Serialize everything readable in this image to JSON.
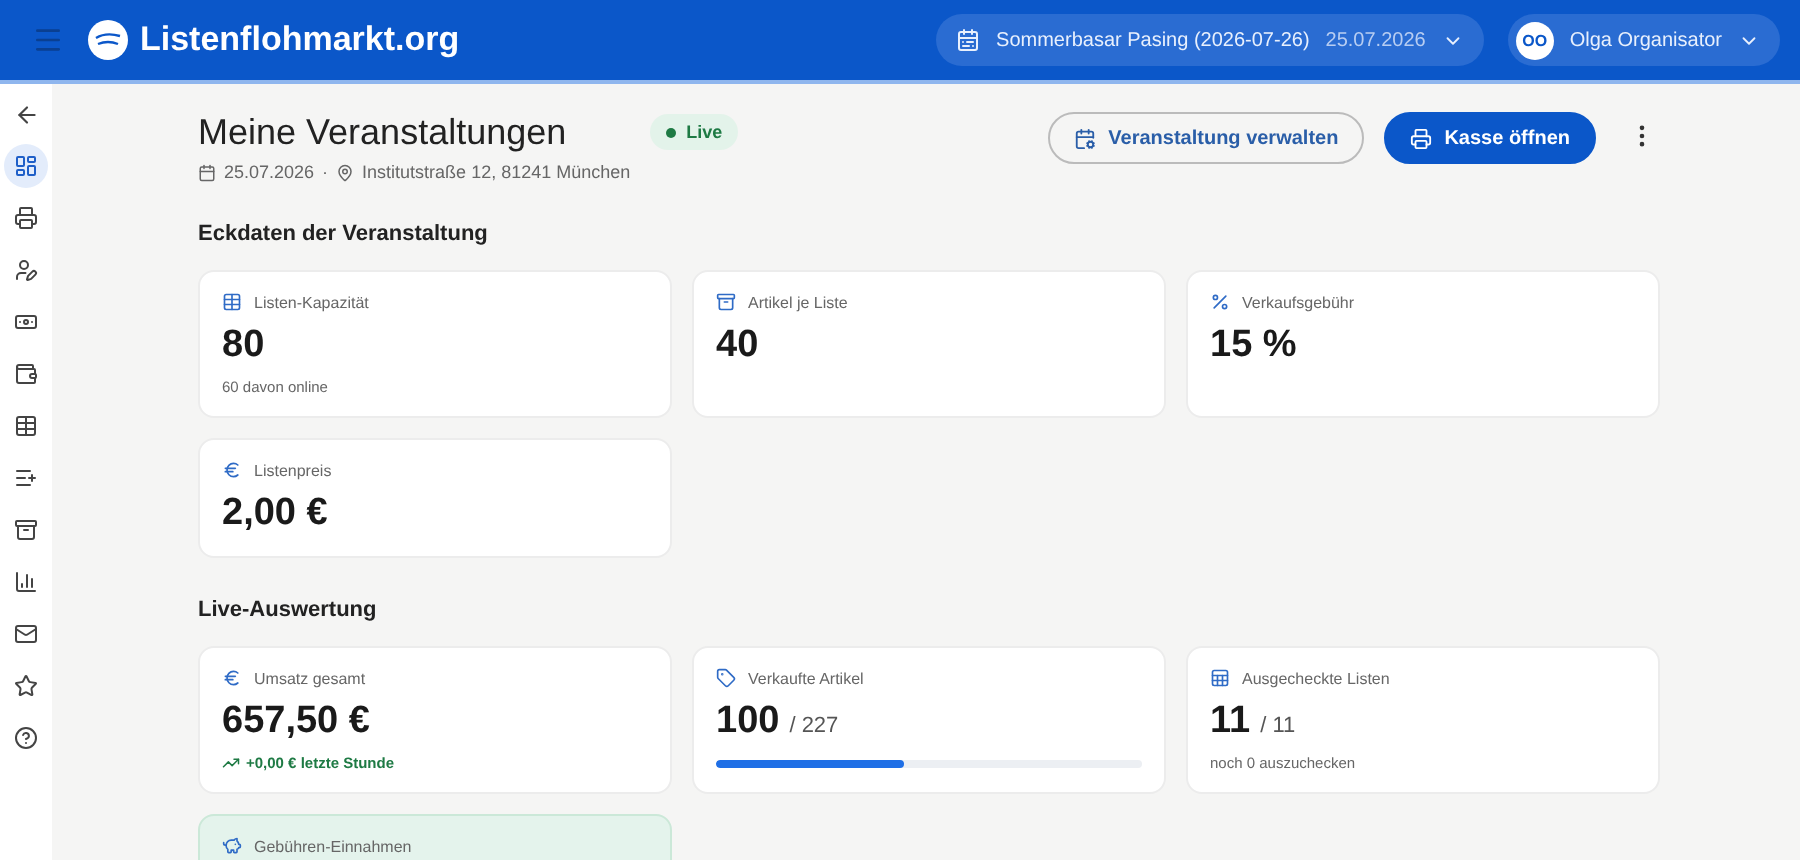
{
  "header": {
    "logo": "Listenflohmarkt.org",
    "event_selector": {
      "name": "Sommerbasar Pasing (2026-07-26)",
      "date": "25.07.2026"
    },
    "user": {
      "initials": "OO",
      "name": "Olga Organisator"
    }
  },
  "sidebar": {
    "items": [
      {
        "selected": true
      },
      {
        "selected": false
      },
      {
        "selected": false
      },
      {
        "selected": false
      },
      {
        "selected": false
      },
      {
        "selected": false
      },
      {
        "selected": false
      },
      {
        "selected": false
      },
      {
        "selected": false
      },
      {
        "selected": false
      },
      {
        "selected": false
      },
      {
        "selected": false
      }
    ]
  },
  "page": {
    "title": "Meine Veranstaltungen",
    "status": {
      "label": "Live",
      "kind": "live"
    },
    "date": "25.07.2026",
    "separator": "·",
    "address": "Institutstraße 12, 81241 München",
    "actions": [
      {
        "label": "Veranstaltung verwalten",
        "kind": "outline"
      },
      {
        "label": "Kasse öffnen",
        "kind": "primary"
      }
    ]
  },
  "sections": [
    {
      "title": "Eckdaten der Veranstaltung",
      "cards": [
        {
          "kind": "stat",
          "label": "Listen-Kapazität",
          "value": "80",
          "note": "60 davon online"
        },
        {
          "kind": "stat",
          "label": "Artikel je Liste",
          "value": "40"
        },
        {
          "kind": "stat",
          "label": "Verkaufsgebühr",
          "value": "15 %"
        },
        {
          "kind": "stat",
          "label": "Listenpreis",
          "value": "2,00 €"
        }
      ]
    },
    {
      "title": "Live-Auswertung",
      "cards": [
        {
          "kind": "trend",
          "label": "Umsatz gesamt",
          "value": "657,50 €",
          "trend": "+0,00 € letzte Stunde"
        },
        {
          "kind": "progress",
          "label": "Verkaufte Artikel",
          "value": "100",
          "total": "/ 227",
          "level": 0.44
        },
        {
          "kind": "stat",
          "label": "Ausgecheckte Listen",
          "value": "11",
          "total": "/ 11",
          "note": "noch 0 auszuchecken"
        },
        {
          "kind": "highlight",
          "label": "Gebühren-Einnahmen"
        }
      ]
    }
  ]
}
